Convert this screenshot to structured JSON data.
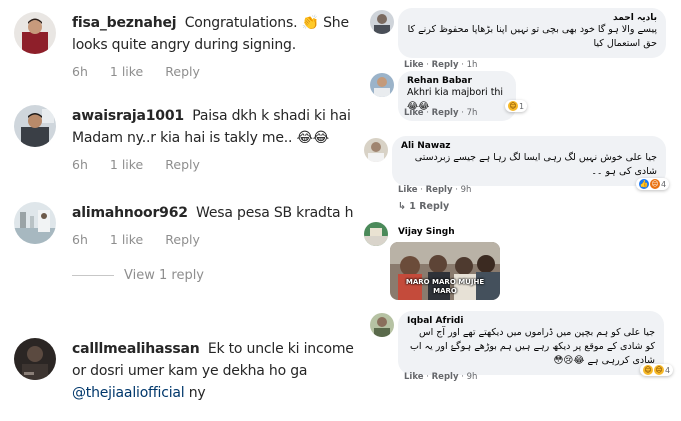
{
  "instagram": {
    "comments": [
      {
        "username": "fisa_beznahej",
        "text_a": "Congratulations.",
        "emoji": "👏",
        "text_b": "She looks quite angry during signing.",
        "time": "6h",
        "likes": "1 like",
        "reply": "Reply"
      },
      {
        "username": "awaisraja1001",
        "text_a": "Paisa dkh k shadi ki hai Madam ny..r kia hai is takly me..",
        "emoji": "😂😂",
        "time": "6h",
        "likes": "1 like",
        "reply": "Reply"
      },
      {
        "username": "alimahnoor962",
        "text_a": "Wesa pesa SB kradta h",
        "time": "6h",
        "likes": "1 like",
        "reply": "Reply"
      },
      {
        "username": "calllmealihassan",
        "text_a": "Ek to uncle ki income or dosri umer kam ye dekha ho ga",
        "mention": "@thejiaaliofficial",
        "text_b": "ny"
      }
    ],
    "view_replies": "View 1 reply"
  },
  "facebook": {
    "comments": [
      {
        "name": "بادیہ احمد",
        "text": "پیسے والا ہو گا خود بھی بچی تو نہیں اپنا بڑھاپا محفوظ کرنے کا حق استعمال کیا",
        "like": "Like",
        "reply": "Reply",
        "time": "1h"
      },
      {
        "name": "Rehan Babar",
        "text": "Akhri kia majbori thi",
        "emoji": "😂😂",
        "like": "Like",
        "reply": "Reply",
        "time": "7h",
        "reactions": "1"
      },
      {
        "name": "Ali Nawaz",
        "text": "جیا علی خوش نہیں لگ رہی ایسا لگ رہا ہے جیسے زبردستی شادی کی ہو ۔۔",
        "like": "Like",
        "reply": "Reply",
        "time": "9h",
        "reactions": "4",
        "replies_link": "1 Reply"
      },
      {
        "name": "Vijay Singh",
        "gif_caption": "MARO MARO MUJHE MARO"
      },
      {
        "name": "Iqbal Afridi",
        "text": "جیا علی کو ہم بچپن میں ڈراموں میں دیکھتے تھے اور آج اس کو شادی کے موقع پر دیکھ رہے ہیں ہم بوڑھے ہوگۓ اور یہ اب شادی کررہی ہے",
        "emoji": "😂😢😳",
        "like": "Like",
        "reply": "Reply",
        "time": "9h",
        "reactions": "4"
      }
    ]
  }
}
